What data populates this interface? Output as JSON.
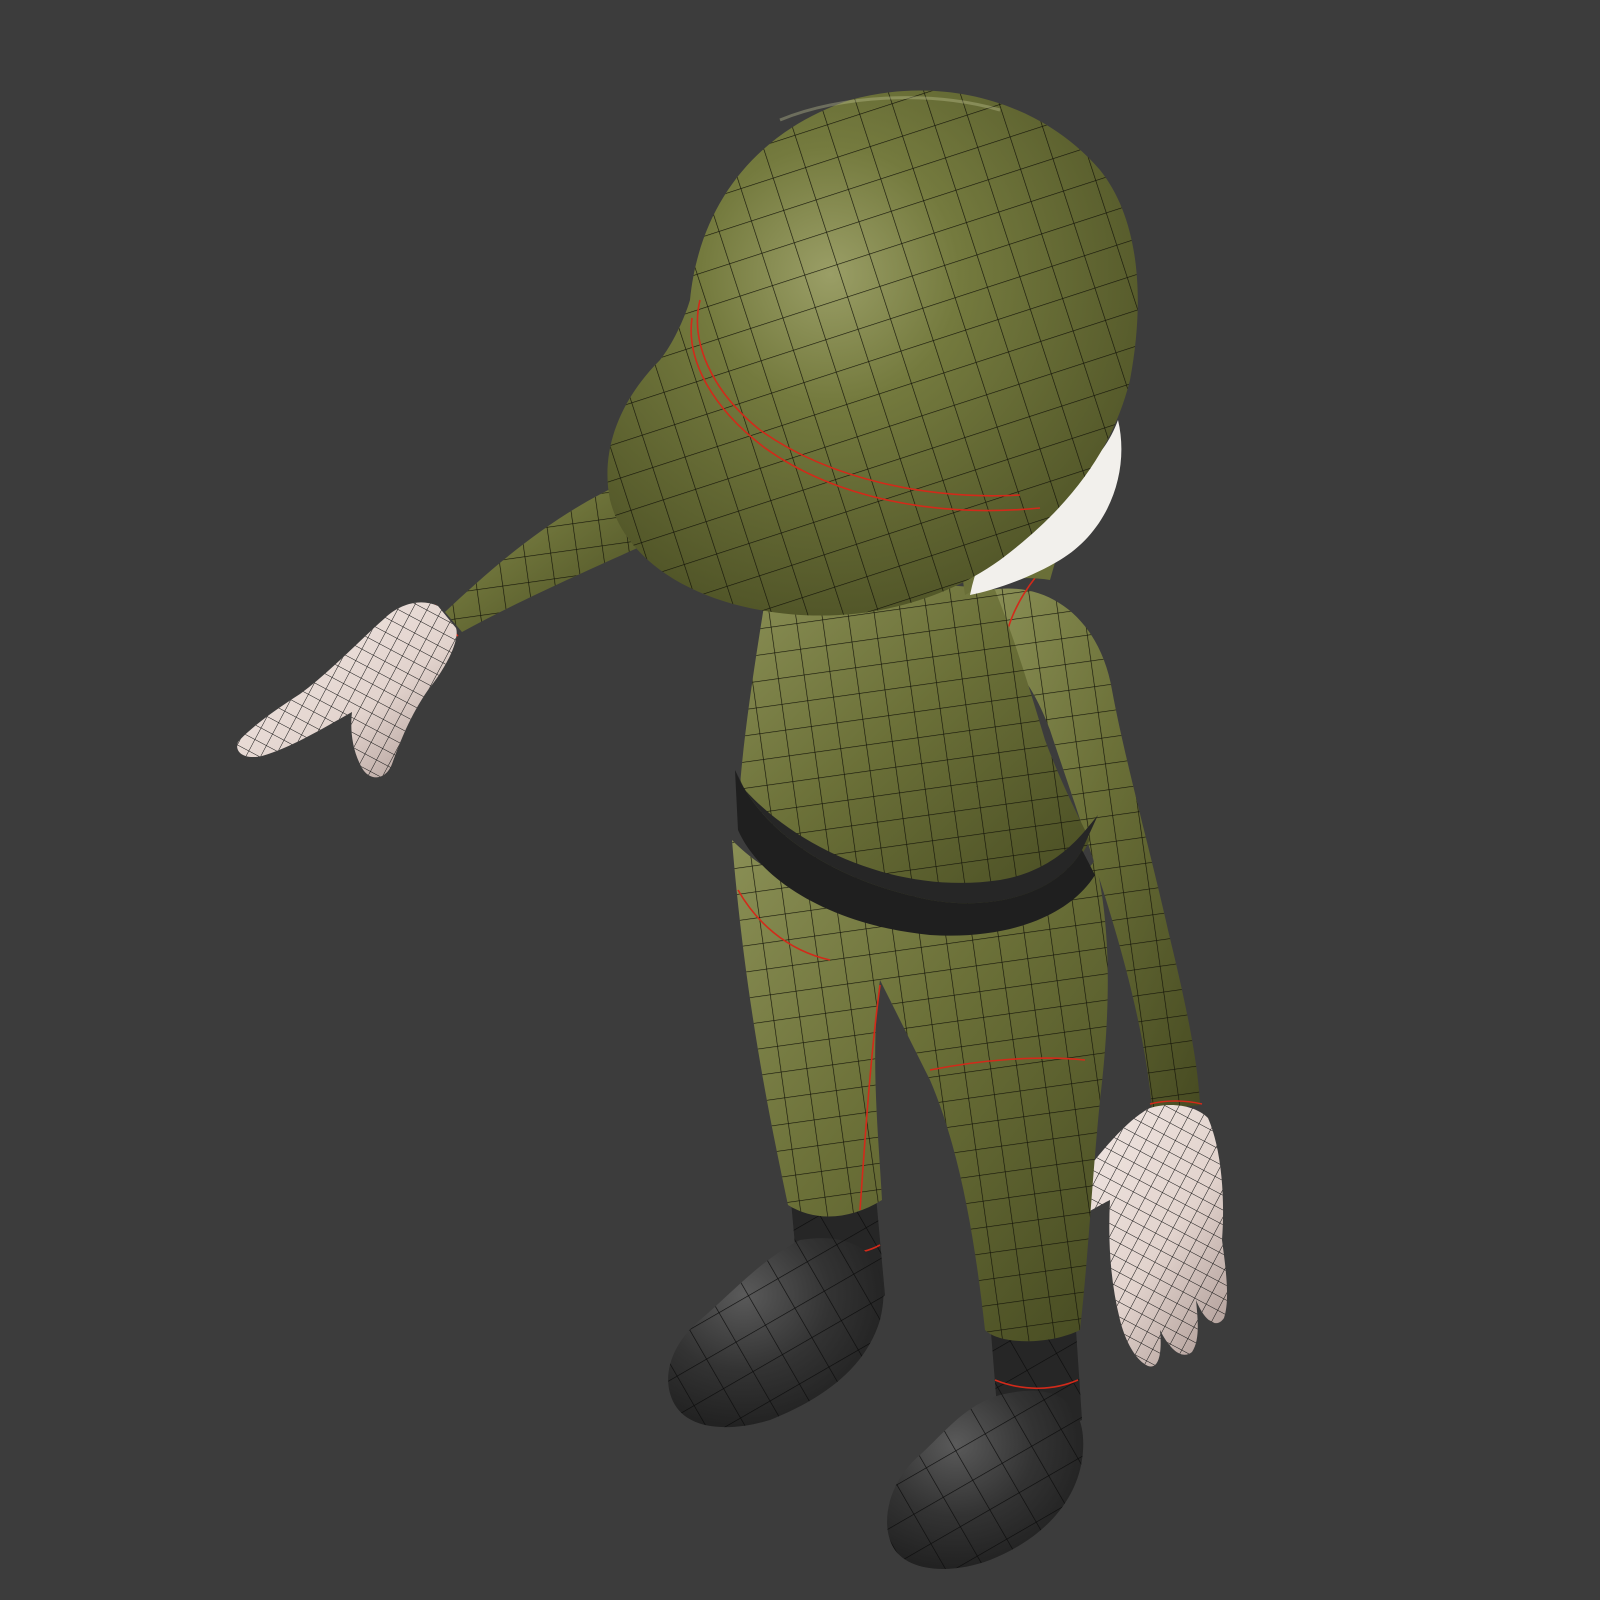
{
  "scene": {
    "background_color": "#3c3c3c",
    "materials": {
      "uniform": "#6b7038",
      "uniform_light": "#8a8f55",
      "uniform_dark": "#474b22",
      "skin": "#e9dcd6",
      "skin_shadow": "#a89590",
      "boot": "#2c2c2c",
      "boot_light": "#5a5a5a",
      "belt": "#262626",
      "wire": "#1a1a10",
      "seam": "#d22a1a"
    }
  }
}
